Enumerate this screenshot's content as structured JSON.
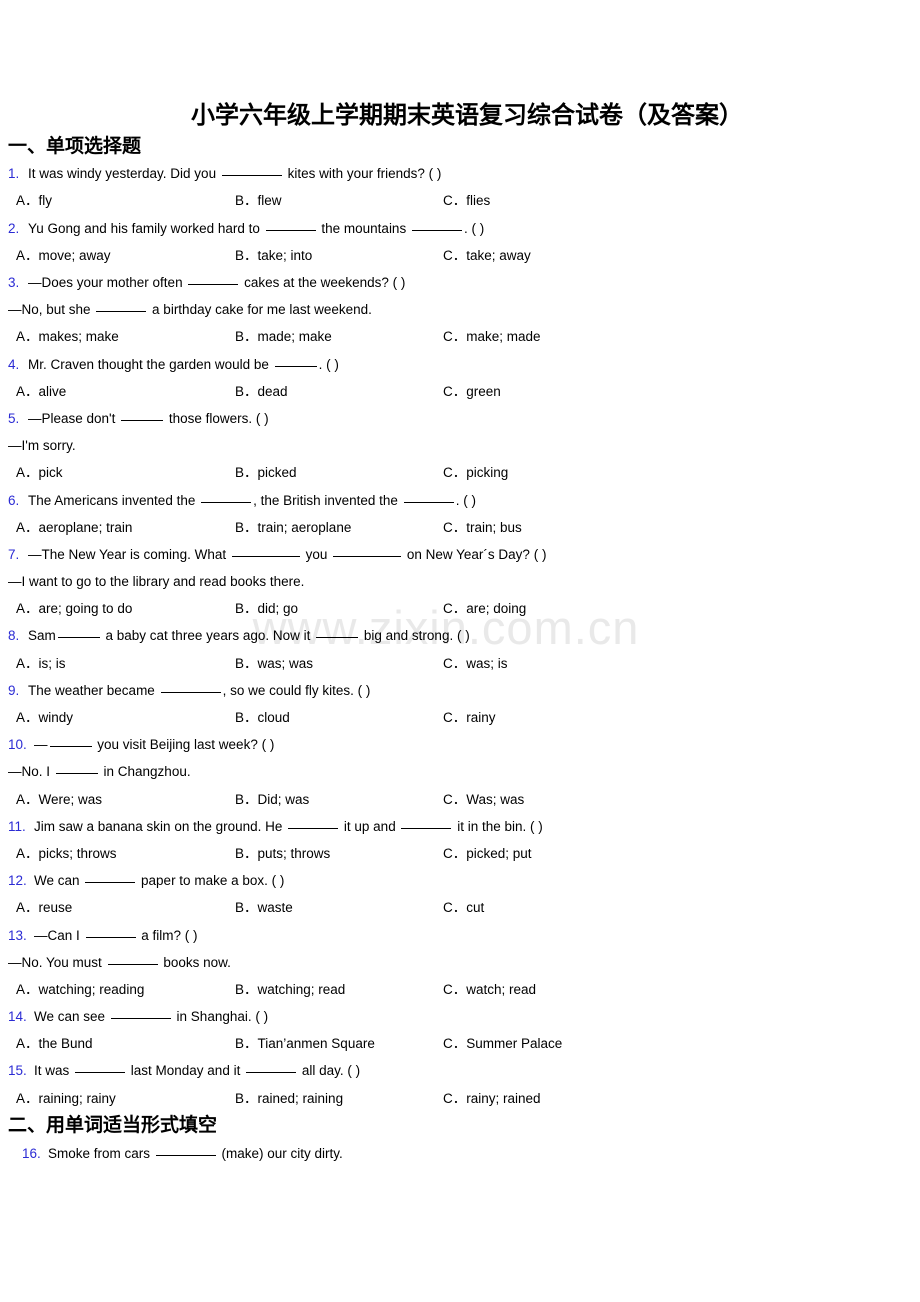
{
  "document": {
    "title": "小学六年级上学期期末英语复习综合试卷（及答案）",
    "watermark": "www.zixin.com.cn",
    "accent_color": "#2b2bd4"
  },
  "sections": [
    {
      "id": "section-1",
      "heading": "一、单项选择题"
    },
    {
      "id": "section-2",
      "heading": "二、用单词适当形式填空"
    }
  ],
  "questions": [
    {
      "num": "1.",
      "stem_pre": "It was windy yesterday. Did you ",
      "stem_mid": " kites with your friends? (   )",
      "options": [
        {
          "label": "A．",
          "text": "fly"
        },
        {
          "label": "B．",
          "text": "flew"
        },
        {
          "label": "C．",
          "text": "flies"
        }
      ]
    },
    {
      "num": "2.",
      "stem_pre": "Yu Gong and his family worked hard to ",
      "stem_mid": " the mountains ",
      "stem_post": ". (  )",
      "options": [
        {
          "label": "A．",
          "text": "move; away"
        },
        {
          "label": "B．",
          "text": "take; into"
        },
        {
          "label": "C．",
          "text": "take; away"
        }
      ]
    },
    {
      "num": "3.",
      "stem_pre": "—Does your mother often ",
      "stem_mid": " cakes at the weekends? (  )",
      "cont_pre": "—No, but she ",
      "cont_post": " a birthday cake for me last weekend.",
      "options": [
        {
          "label": "A．",
          "text": "makes; make"
        },
        {
          "label": "B．",
          "text": "made; make"
        },
        {
          "label": "C．",
          "text": "make; made"
        }
      ]
    },
    {
      "num": "4.",
      "stem_pre": "Mr. Craven thought the garden would be ",
      "stem_mid": ". (  )",
      "options": [
        {
          "label": "A．",
          "text": "alive"
        },
        {
          "label": "B．",
          "text": "dead"
        },
        {
          "label": "C．",
          "text": "green"
        }
      ]
    },
    {
      "num": "5.",
      "stem_pre": "—Please don't ",
      "stem_mid": " those flowers. (  )",
      "cont_pre": "—I'm sorry.",
      "options": [
        {
          "label": "A．",
          "text": "pick"
        },
        {
          "label": "B．",
          "text": "picked"
        },
        {
          "label": "C．",
          "text": "picking"
        }
      ]
    },
    {
      "num": "6.",
      "stem_pre": "The Americans invented the ",
      "stem_mid": ", the British invented the ",
      "stem_post": ". (  )",
      "options": [
        {
          "label": "A．",
          "text": "aeroplane; train"
        },
        {
          "label": "B．",
          "text": "train; aeroplane"
        },
        {
          "label": "C．",
          "text": "train; bus"
        }
      ]
    },
    {
      "num": "7.",
      "stem_pre": "—The New Year is coming. What ",
      "stem_mid": " you ",
      "stem_post": " on New Year´s Day? (   )",
      "cont_pre": "—I want to go to the library and read books there.",
      "options": [
        {
          "label": "A．",
          "text": "are; going to do"
        },
        {
          "label": "B．",
          "text": "did; go"
        },
        {
          "label": "C．",
          "text": "are; doing"
        }
      ]
    },
    {
      "num": "8.",
      "stem_pre": "Sam",
      "stem_mid": " a baby cat three years ago. Now it ",
      "stem_post": " big and strong. (   )",
      "options": [
        {
          "label": "A．",
          "text": "is; is"
        },
        {
          "label": "B．",
          "text": "was; was"
        },
        {
          "label": "C．",
          "text": "was; is"
        }
      ]
    },
    {
      "num": "9.",
      "stem_pre": "The weather became ",
      "stem_mid": ", so we could fly kites. (  )",
      "options": [
        {
          "label": "A．",
          "text": "windy"
        },
        {
          "label": "B．",
          "text": "cloud"
        },
        {
          "label": "C．",
          "text": "rainy"
        }
      ]
    },
    {
      "num": "10.",
      "stem_pre": "—",
      "stem_mid": " you visit Beijing last week? (  )",
      "cont_pre": "—No. I ",
      "cont_post": " in Changzhou.",
      "options": [
        {
          "label": "A．",
          "text": "Were; was"
        },
        {
          "label": "B．",
          "text": "Did; was"
        },
        {
          "label": "C．",
          "text": "Was; was"
        }
      ]
    },
    {
      "num": "11.",
      "stem_pre": "Jim saw a banana skin on the ground. He ",
      "stem_mid": " it up and ",
      "stem_post": " it in the bin. (  )",
      "options": [
        {
          "label": "A．",
          "text": "picks; throws"
        },
        {
          "label": "B．",
          "text": "puts; throws"
        },
        {
          "label": "C．",
          "text": "picked; put"
        }
      ]
    },
    {
      "num": "12.",
      "stem_pre": "We can ",
      "stem_mid": " paper to make a box. (  )",
      "options": [
        {
          "label": "A．",
          "text": "reuse"
        },
        {
          "label": "B．",
          "text": "waste"
        },
        {
          "label": "C．",
          "text": "cut"
        }
      ]
    },
    {
      "num": "13.",
      "stem_pre": "—Can I ",
      "stem_mid": " a film? (  )",
      "cont_pre": "—No. You must ",
      "cont_post": " books now.",
      "options": [
        {
          "label": "A．",
          "text": "watching; reading"
        },
        {
          "label": "B．",
          "text": "watching; read"
        },
        {
          "label": "C．",
          "text": "watch; read"
        }
      ]
    },
    {
      "num": "14.",
      "stem_pre": "We can see ",
      "stem_mid": " in Shanghai. (  )",
      "options": [
        {
          "label": "A．",
          "text": "the Bund"
        },
        {
          "label": "B．",
          "text": "Tian’anmen Square"
        },
        {
          "label": "C．",
          "text": "Summer Palace"
        }
      ]
    },
    {
      "num": "15.",
      "stem_pre": "It was ",
      "stem_mid": " last Monday and it ",
      "stem_post": " all day. (  )",
      "options": [
        {
          "label": "A．",
          "text": "raining; rainy"
        },
        {
          "label": "B．",
          "text": "rained; raining"
        },
        {
          "label": "C．",
          "text": "rainy; rained"
        }
      ]
    },
    {
      "num": "16.",
      "stem_pre": "Smoke from cars ",
      "stem_mid": " (make) our city dirty."
    }
  ]
}
